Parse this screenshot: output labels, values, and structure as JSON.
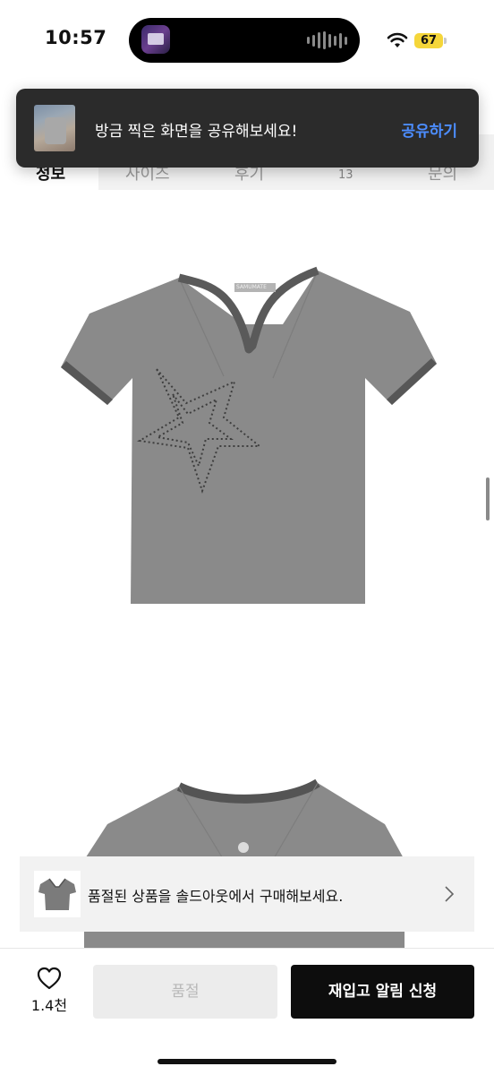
{
  "status_bar": {
    "time": "10:57",
    "battery": "67",
    "battery_color": "#f5d63a",
    "icons": [
      "dynamic-island-app-icon",
      "audio-wave-icon",
      "wifi-icon",
      "battery-icon"
    ]
  },
  "tabs": {
    "items": [
      {
        "label": "정보",
        "active": true
      },
      {
        "label": "사이즈",
        "active": false
      },
      {
        "label": "후기",
        "active": false
      },
      {
        "label": "문의",
        "active": false
      }
    ],
    "review_count": "13"
  },
  "share_toast": {
    "message": "방금 찍은 화면을 공유해보세요!",
    "action": "공유하기",
    "action_color": "#4c8dff",
    "thumbnail_icon": "screenshot-thumbnail"
  },
  "product": {
    "images": [
      "grey-vneck-star-tshirt-front",
      "grey-tshirt-back"
    ],
    "brand_tag": "SAMUMATE"
  },
  "soldout_banner": {
    "text": "품절된 상품을 솔드아웃에서 구매해보세요.",
    "icon": "chevron-right-icon"
  },
  "bottom_bar": {
    "like_count": "1.4천",
    "soldout_label": "품절",
    "restock_label": "재입고 알림 신청",
    "icon": "heart-icon"
  }
}
